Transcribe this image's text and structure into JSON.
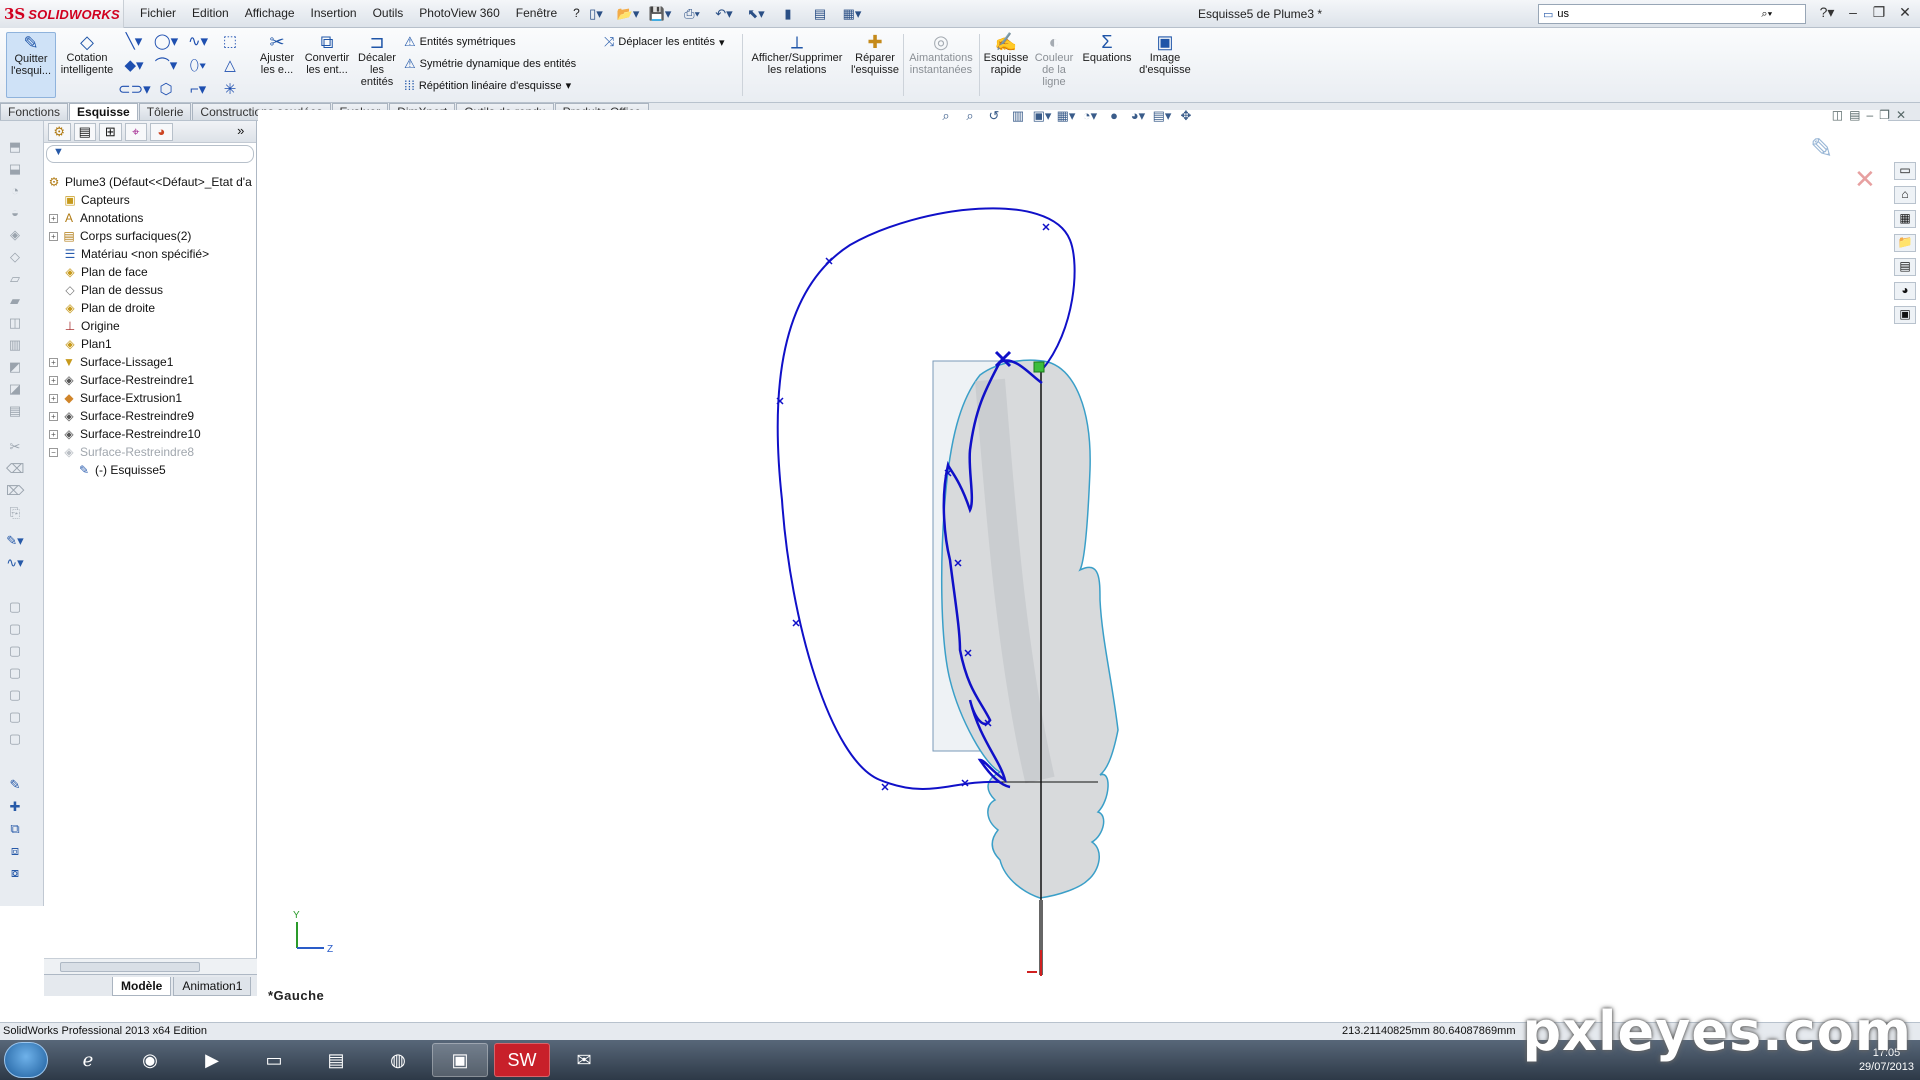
{
  "app": {
    "logo_ds": "3S",
    "logo_text": "SOLIDWORKS",
    "document_title": "Esquisse5 de Plume3 *"
  },
  "menu": [
    "Fichier",
    "Edition",
    "Affichage",
    "Insertion",
    "Outils",
    "PhotoView 360",
    "Fenêtre",
    "?"
  ],
  "search": {
    "value": "us"
  },
  "ribbon": {
    "exit_sketch": "Quitter l'esqui...",
    "smart_dimension": "Cotation intelligente",
    "trim": "Ajuster les e...",
    "convert": "Convertir les ent...",
    "offset": "Décaler les entités",
    "mirror": "Entités symétriques",
    "dyn_mirror": "Symétrie dynamique des entités",
    "linear_pattern": "Répétition linéaire d'esquisse",
    "move": "Déplacer les entités",
    "relations": "Afficher/Supprimer les relations",
    "repair": "Réparer l'esquisse",
    "snaps": "Aimantations instantanées",
    "rapid_sketch": "Esquisse rapide",
    "line_color": "Couleur de la ligne",
    "equations": "Equations",
    "sketch_picture": "Image d'esquisse"
  },
  "tabs": [
    {
      "label": "Fonctions",
      "selected": false
    },
    {
      "label": "Esquisse",
      "selected": true
    },
    {
      "label": "Tôlerie",
      "selected": false
    },
    {
      "label": "Constructions soudées",
      "selected": false
    },
    {
      "label": "Evaluer",
      "selected": false
    },
    {
      "label": "DimXpert",
      "selected": false
    },
    {
      "label": "Outils de rendu",
      "selected": false
    },
    {
      "label": "Produits Office",
      "selected": false
    }
  ],
  "tree": {
    "root": "Plume3  (Défaut<<Défaut>_Etat d'a",
    "items": [
      {
        "label": "Capteurs",
        "icon": "sensor-icon"
      },
      {
        "label": "Annotations",
        "icon": "annotations-icon"
      },
      {
        "label": "Corps surfaciques(2)",
        "icon": "surface-bodies-icon"
      },
      {
        "label": "Matériau <non spécifié>",
        "icon": "material-icon"
      },
      {
        "label": "Plan de face",
        "icon": "plane-icon"
      },
      {
        "label": "Plan de dessus",
        "icon": "plane-icon"
      },
      {
        "label": "Plan de droite",
        "icon": "plane-icon"
      },
      {
        "label": "Origine",
        "icon": "origin-icon"
      },
      {
        "label": "Plan1",
        "icon": "plane-icon"
      },
      {
        "label": "Surface-Lissage1",
        "icon": "loft-icon"
      },
      {
        "label": "Surface-Restreindre1",
        "icon": "trim-surface-icon"
      },
      {
        "label": "Surface-Extrusion1",
        "icon": "extrude-surface-icon"
      },
      {
        "label": "Surface-Restreindre9",
        "icon": "trim-surface-icon"
      },
      {
        "label": "Surface-Restreindre10",
        "icon": "trim-surface-icon"
      },
      {
        "label": "Surface-Restreindre8",
        "icon": "trim-surface-icon"
      },
      {
        "label": "(-) Esquisse5",
        "icon": "sketch-icon"
      }
    ]
  },
  "bottom_tabs": [
    "Modèle",
    "Animation1"
  ],
  "viewport": {
    "view_label": "*Gauche",
    "axis_y": "Y",
    "axis_z": "Z"
  },
  "status": {
    "product": "SolidWorks Professional 2013 x64 Edition",
    "coords": "213.21140825mm  80.64087869mm"
  },
  "taskbar": {
    "time": "17:05",
    "date": "29/07/2013"
  },
  "watermark": "pxleyes.com",
  "colors": {
    "sketch_blue": "#1010c8",
    "surface_outline": "#3a9fc8",
    "brand_red": "#d1001f"
  }
}
